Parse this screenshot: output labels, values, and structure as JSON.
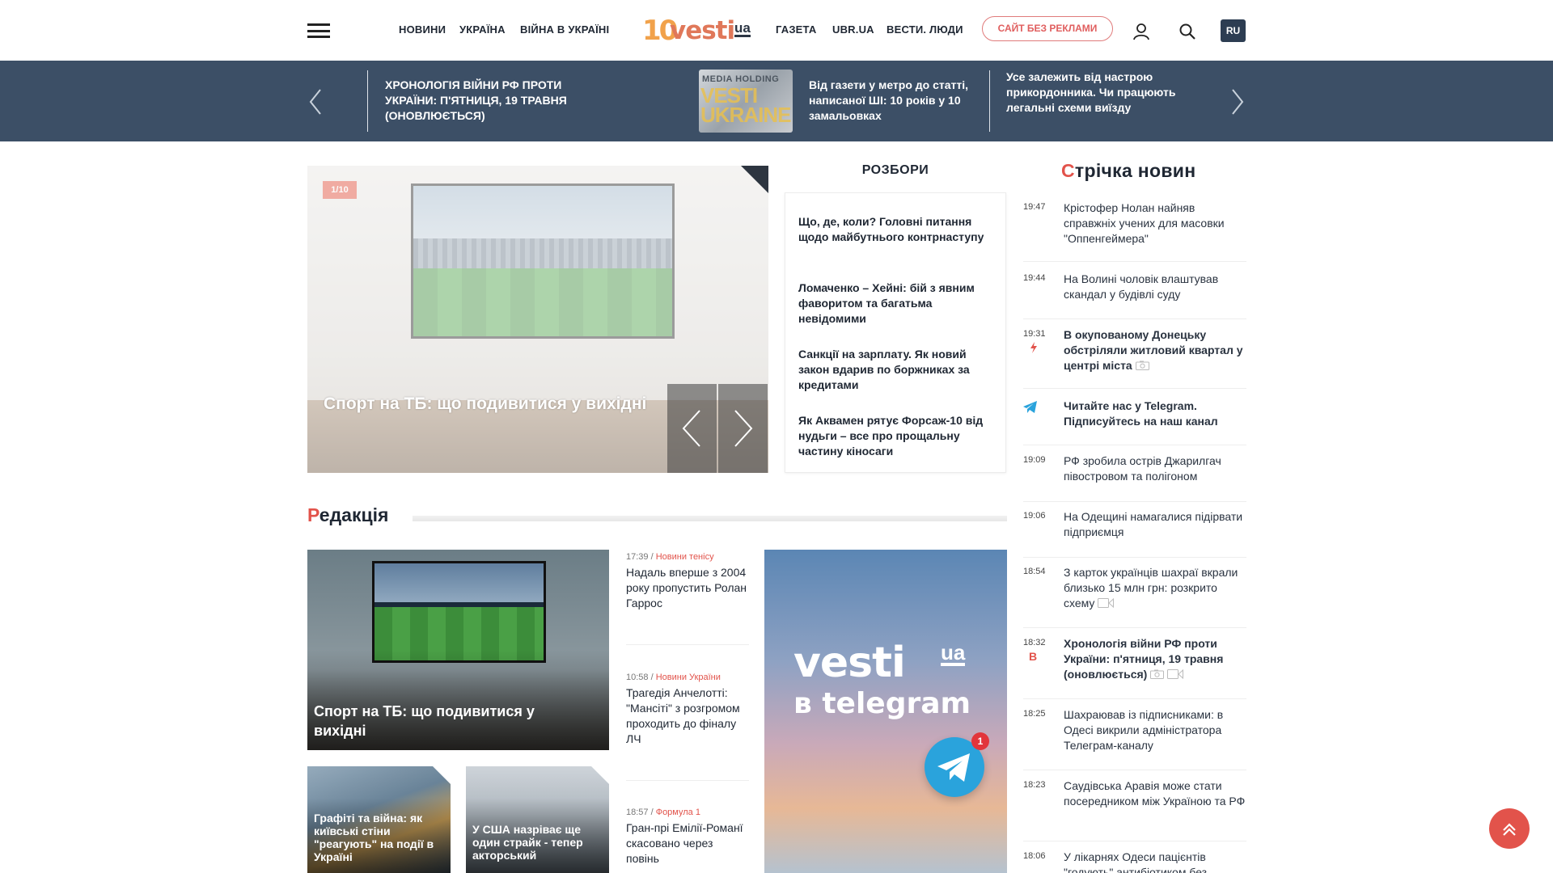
{
  "header": {
    "nav": [
      "НОВИНИ",
      "УКРАЇНА",
      "ВІЙНА В УКРАЇНІ",
      "ГАЗЕТА",
      "UBR.UA",
      "ВЕСТИ. ЛЮДИ"
    ],
    "logo_num": "10",
    "logo_word": "vesti",
    "logo_ua": "ua",
    "no_ads_button": "САЙТ БЕЗ РЕКЛАМИ",
    "lang": "RU"
  },
  "top_slider": {
    "items": [
      {
        "text": "ХРОНОЛОГІЯ ВІЙНИ РФ ПРОТИ УКРАЇНИ: П'ЯТНИЦЯ, 19 ТРАВНЯ (ОНОВЛЮЄТЬСЯ)"
      },
      {
        "text": "Від газети у метро до статті, написаної ШІ: 10 років у 10 замальовках",
        "thumb_top": "MEDIA HOLDING",
        "thumb_main": "VESTI UKRAINE"
      },
      {
        "text": "Усе залежить від настрою прикордонника. Чи працюють легальні схеми виїзду"
      }
    ]
  },
  "hero": {
    "counter": "1/10",
    "title": "Спорт на ТБ: що подивитися у вихідні"
  },
  "rozbory": {
    "title": "РОЗБОРИ",
    "items": [
      "Що, де, коли? Головні питання щодо майбутнього контрнаступу",
      "Ломаченко – Хейні: бій з явним фаворитом та багатьма невідомими",
      "Санкції на зарплату. Як новий закон вдарив по боржниках за кредитами",
      "Як Аквамен рятує Форсаж-10 від нудьги – все про прощальну частину кіносаги"
    ]
  },
  "feed": {
    "title_first": "С",
    "title_rest": "трічка новин",
    "items": [
      {
        "time": "19:47",
        "text": "Крістофер Нолан найняв справжніх учених для масовки \"Оппенгеймера\""
      },
      {
        "time": "19:44",
        "text": "На Волині чоловік влаштував скандал у будівлі суду"
      },
      {
        "time": "19:31",
        "text": "В окупованому Донецьку обстріляли житловий квартал у центрі міста"
      },
      {
        "time": "",
        "text": "Читайте нас у Telegram. Підписуйтесь на наш канал"
      },
      {
        "time": "19:09",
        "text": "РФ зробила острів Джарилгач півостровом та полігоном"
      },
      {
        "time": "19:06",
        "text": "На Одещині намагалися підірвати підприємця"
      },
      {
        "time": "18:54",
        "text": "З карток українців шахраї вкрали близько 15 млн грн: розкрито схему"
      },
      {
        "time": "18:32",
        "text": "Хронологія війни РФ проти України: п'ятниця, 19 травня (оновлюється)",
        "badge": "В"
      },
      {
        "time": "18:25",
        "text": "Шахраював із підписниками: в Одесі викрили адміністратора Телеграм-каналу"
      },
      {
        "time": "18:23",
        "text": "Саудівська Аравія може стати посередником між Україною та РФ"
      },
      {
        "time": "18:06",
        "text": "У лікарнях Одеси пацієнтів \"годують\" антибіотиком без"
      }
    ]
  },
  "editorial": {
    "title_first": "Р",
    "title_rest": "едакція",
    "big_card": "Спорт на ТБ: що подивитися у вихідні",
    "small_cards": [
      "Графіті та війна: як київські стіни \"реагують\" на події в Україні",
      "У США назріває ще один страйк - тепер акторський"
    ],
    "side_news": [
      {
        "time": "17:39 /",
        "cat": "Новини тенісу",
        "text": "Надаль вперше з 2004 року пропустить Ролан Гаррос"
      },
      {
        "time": "10:58 /",
        "cat": "Новини України",
        "text": "Трагедія Анчелотті: \"Мансіті\" з розгромом проходить до фіналу ЛЧ"
      },
      {
        "time": "18:57 /",
        "cat": "Формула 1",
        "text": "Гран-прі Емілії-Романї скасовано через повінь"
      }
    ]
  },
  "telegram_promo": {
    "brand": "vesti",
    "brand_ua": "ua",
    "sub": "в telegram",
    "badge": "1"
  },
  "colors": {
    "accent": "#e2534b",
    "band": "#3c4f66",
    "telegram": "#2aa3dc"
  }
}
